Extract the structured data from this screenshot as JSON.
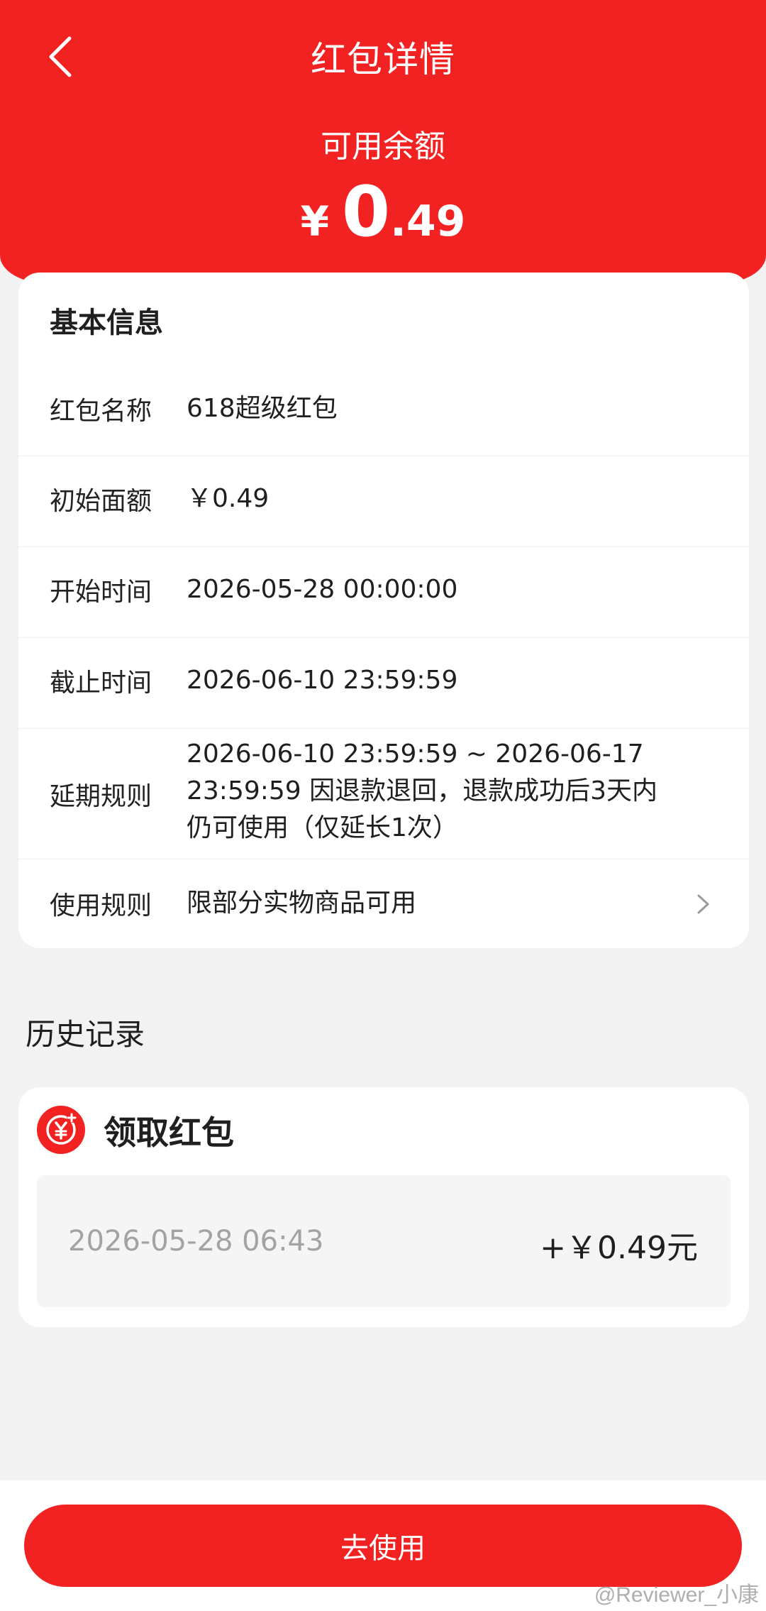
{
  "header": {
    "title": "红包详情",
    "balance_label": "可用余额",
    "currency_symbol": "¥",
    "balance_integer": "0",
    "balance_decimal": ".49"
  },
  "basic_info": {
    "title": "基本信息",
    "rows": [
      {
        "label": "红包名称",
        "value": "618超级红包"
      },
      {
        "label": "初始面额",
        "value": "￥0.49"
      },
      {
        "label": "开始时间",
        "value": "2026-05-28 00:00:00"
      },
      {
        "label": "截止时间",
        "value": "2026-06-10 23:59:59"
      },
      {
        "label": "延期规则",
        "value_lines": [
          "2026-06-10 23:59:59 ~ 2026-06-17",
          "23:59:59 因退款退回，退款成功后3天内",
          "仍可使用（仅延长1次）"
        ]
      },
      {
        "label": "使用规则",
        "value": "限部分实物商品可用"
      }
    ]
  },
  "history": {
    "title": "历史记录",
    "records": [
      {
        "type": "领取红包",
        "time": "2026-05-28 06:43",
        "amount": "+￥0.49元"
      }
    ]
  },
  "action": {
    "button_label": "去使用"
  },
  "watermark": "@Reviewer_小康",
  "colors": {
    "primary_red": "#f32222",
    "background": "#f2f2f2"
  },
  "icons": [
    "back-arrow-icon",
    "chevron-right-icon",
    "yen-coin-icon"
  ]
}
